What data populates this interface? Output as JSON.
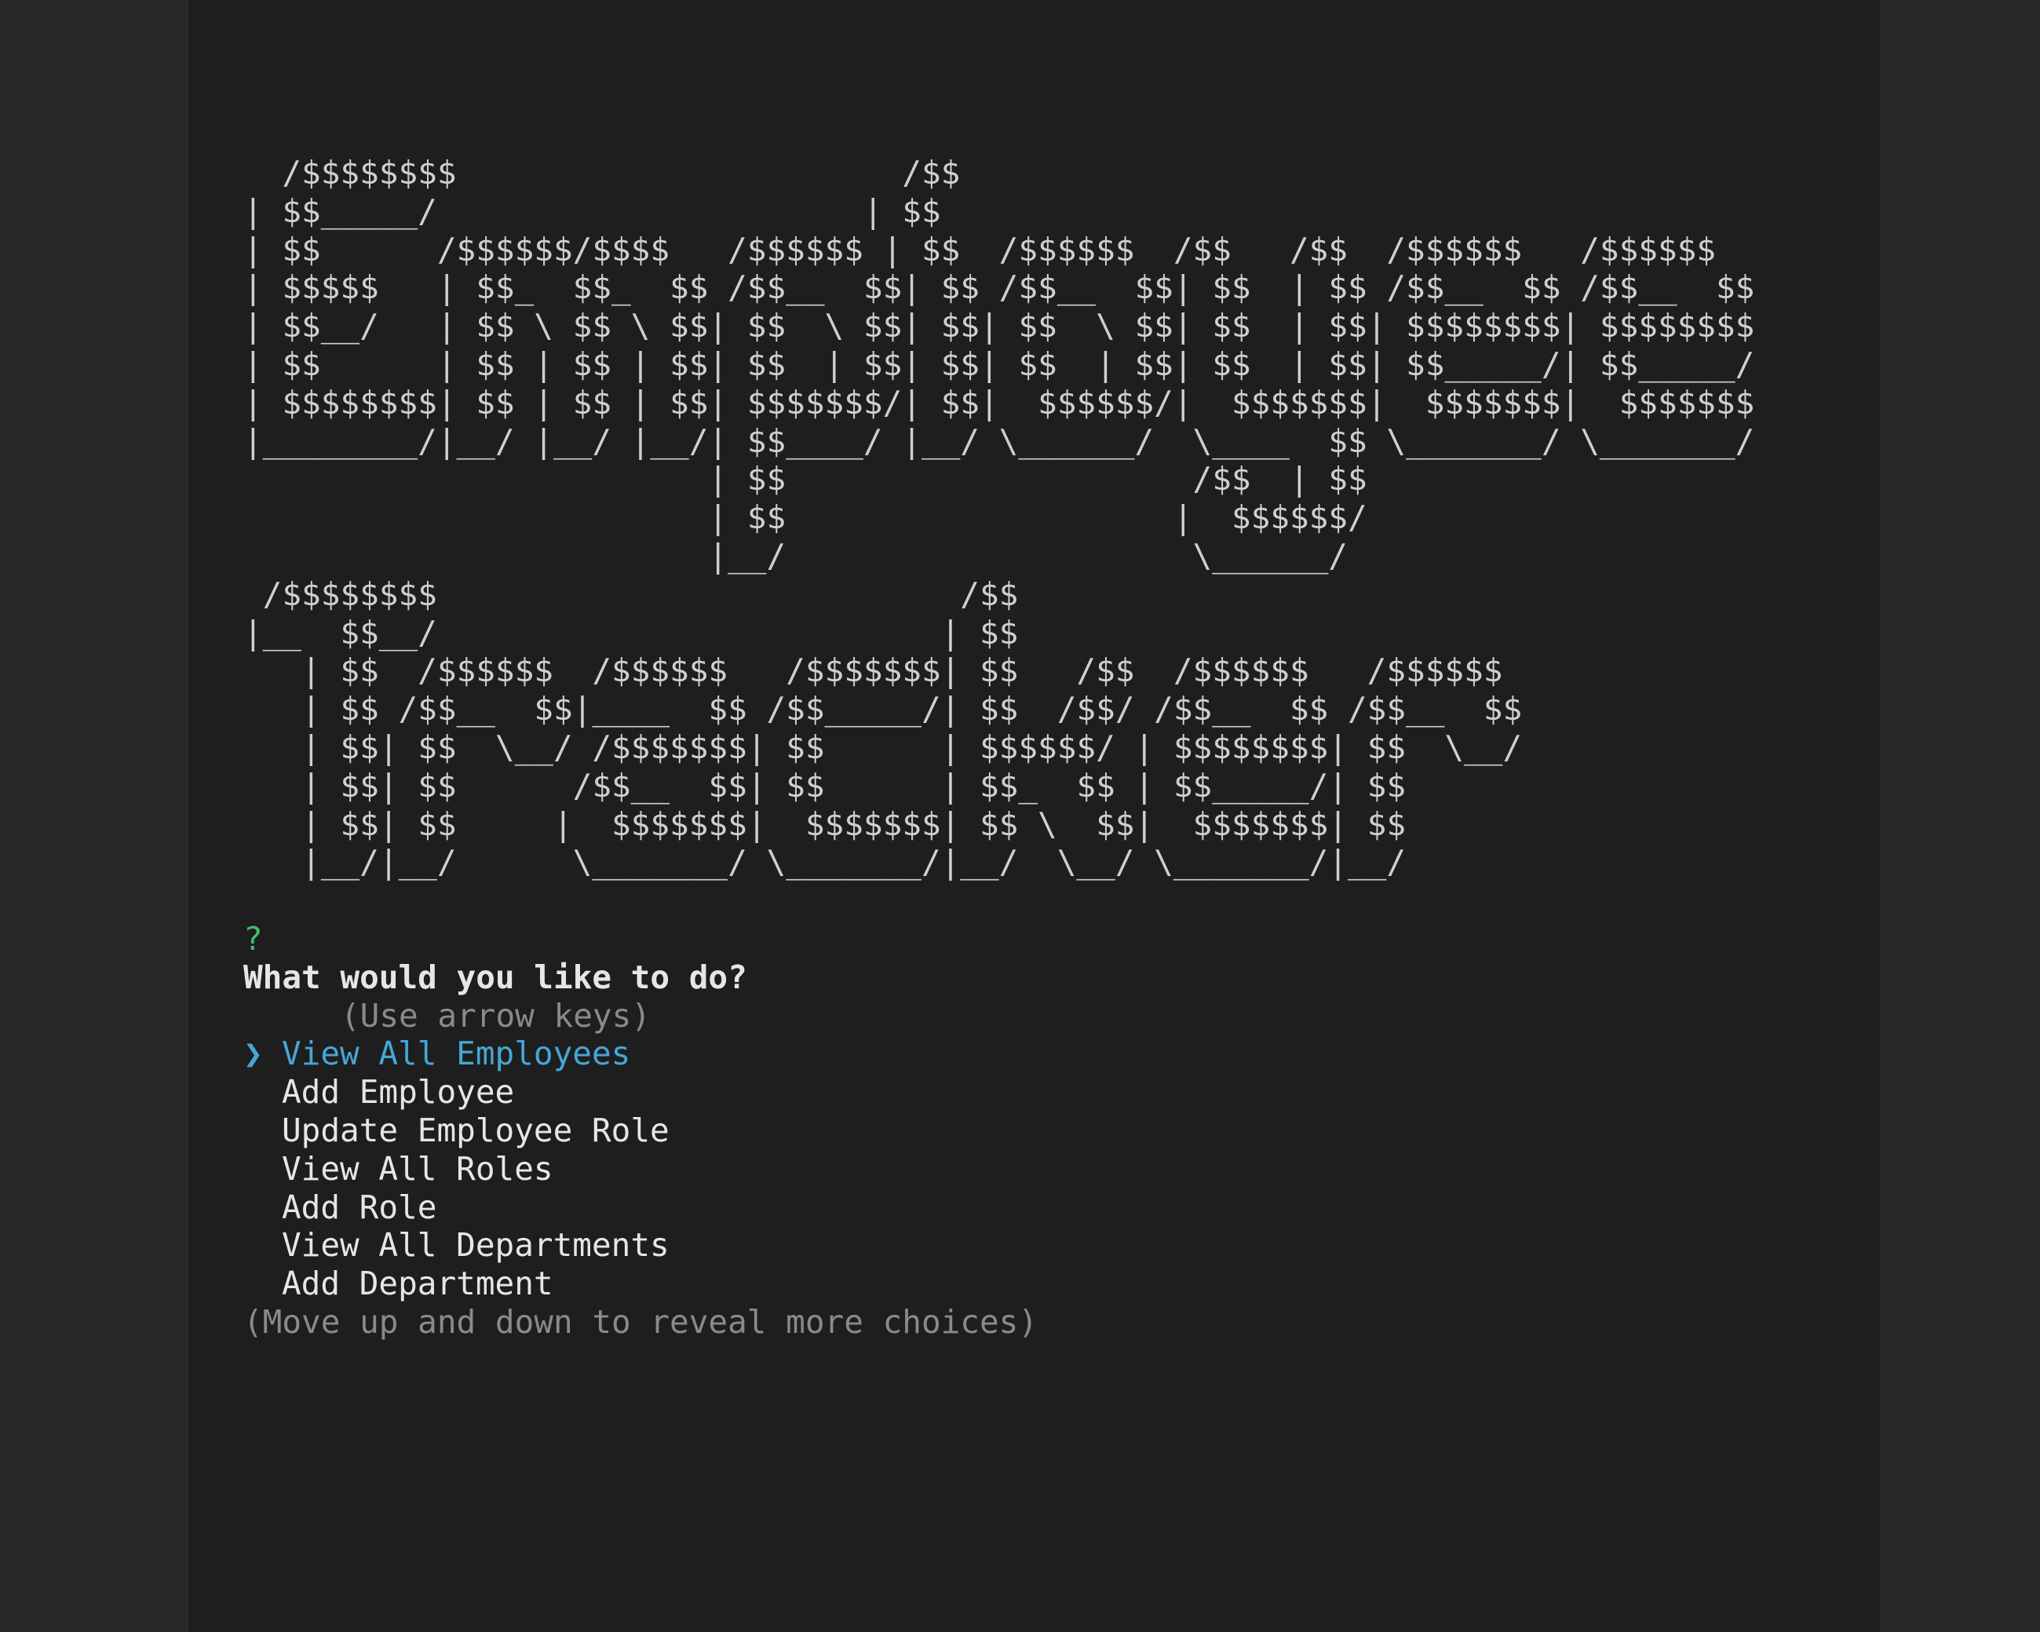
{
  "banner": {
    "ascii_lines": [
      "  /$$$$$$$$                       /$$",
      "| $$_____/                      | $$",
      "| $$      /$$$$$$/$$$$   /$$$$$$ | $$  /$$$$$$  /$$   /$$  /$$$$$$   /$$$$$$",
      "| $$$$$   | $$_  $$_  $$ /$$__  $$| $$ /$$__  $$| $$  | $$ /$$__  $$ /$$__  $$",
      "| $$__/   | $$ \\ $$ \\ $$| $$  \\ $$| $$| $$  \\ $$| $$  | $$| $$$$$$$$| $$$$$$$$",
      "| $$      | $$ | $$ | $$| $$  | $$| $$| $$  | $$| $$  | $$| $$_____/| $$_____/",
      "| $$$$$$$$| $$ | $$ | $$| $$$$$$$/| $$|  $$$$$$/|  $$$$$$$|  $$$$$$$|  $$$$$$$",
      "|________/|__/ |__/ |__/| $$____/ |__/ \\______/  \\____  $$ \\_______/ \\_______/",
      "                        | $$                     /$$  | $$",
      "                        | $$                    |  $$$$$$/",
      "                        |__/                     \\______/",
      " /$$$$$$$$                           /$$",
      "|__  $$__/                          | $$",
      "   | $$  /$$$$$$  /$$$$$$   /$$$$$$$| $$   /$$  /$$$$$$   /$$$$$$",
      "   | $$ /$$__  $$|____  $$ /$$_____/| $$  /$$/ /$$__  $$ /$$__  $$",
      "   | $$| $$  \\__/ /$$$$$$$| $$      | $$$$$$/ | $$$$$$$$| $$  \\__/",
      "   | $$| $$      /$$__  $$| $$      | $$_  $$ | $$_____/| $$",
      "   | $$| $$     |  $$$$$$$|  $$$$$$$| $$ \\  $$|  $$$$$$$| $$",
      "   |__/|__/      \\_______/ \\_______/|__/  \\__/ \\_______/|__/"
    ]
  },
  "prompt": {
    "question_mark": "?",
    "question": "What would you like to do?",
    "hint": "(Use arrow keys)",
    "pointer": "❯",
    "selected_choice": "View All Employees",
    "choices": [
      "Add Employee",
      "Update Employee Role",
      "View All Roles",
      "Add Role",
      "View All Departments",
      "Add Department"
    ],
    "more_hint": "(Move up and down to reveal more choices)"
  },
  "colors": {
    "background": "#1e1e1e",
    "outer_background": "#282828",
    "text": "#d4d4d4",
    "question_mark": "#3fbf6b",
    "selection": "#45a6d6",
    "hint": "#8a8a8a"
  }
}
